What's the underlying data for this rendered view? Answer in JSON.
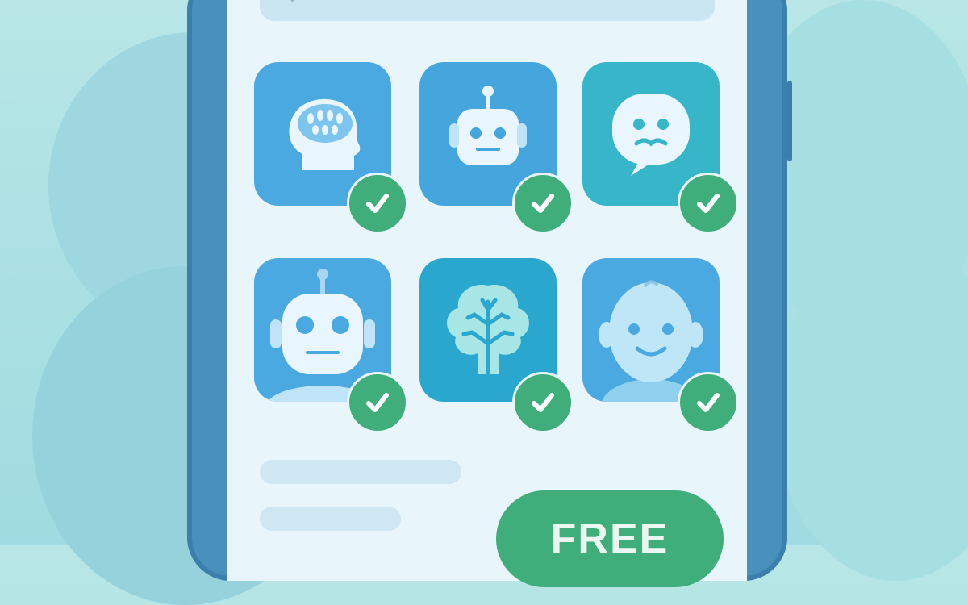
{
  "screen": {
    "search": {
      "icon": "search-icon"
    },
    "apps": [
      {
        "icon": "brain-head-icon",
        "checked": true,
        "tile_color": "#49a9e0"
      },
      {
        "icon": "robot-icon",
        "checked": true,
        "tile_color": "#45a6de"
      },
      {
        "icon": "chat-smile-icon",
        "checked": true,
        "tile_color": "#37b6c9"
      },
      {
        "icon": "robot-icon",
        "checked": true,
        "tile_color": "#49a9e0"
      },
      {
        "icon": "tree-brain-icon",
        "checked": true,
        "tile_color": "#2aa7cf"
      },
      {
        "icon": "baby-face-icon",
        "checked": true,
        "tile_color": "#49a9e0"
      }
    ],
    "cta": {
      "label": "FREE"
    }
  },
  "colors": {
    "background": "#a9dfe2",
    "phone_frame": "#4a90bd",
    "screen": "#e8f5fb",
    "check_badge": "#3fae7b"
  }
}
